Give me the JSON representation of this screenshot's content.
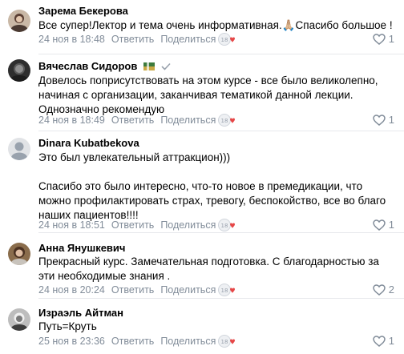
{
  "comments": [
    {
      "author": "Зарема Бекерова",
      "text": "Все супер!Лектор и тема очень информативная.🙏🏼Спасибо большое !",
      "date": "24 ноя в 18:48",
      "reply": "Ответить",
      "share": "Поделиться",
      "likes": "1"
    },
    {
      "author": "Вячеслав Сидоров",
      "text": "Довелось поприсутствовать на этом курсе - все было великолепно, начиная с организации, заканчивая тематикой данной лекции. Однозначно рекомендую",
      "date": "24 ноя в 18:49",
      "reply": "Ответить",
      "share": "Поделиться",
      "likes": "1"
    },
    {
      "author": "Dinara Kubatbekova",
      "text": "Это был увлекательный аттракцион)))\n\nСпасибо это было интересно, что-то новое в премедикации, что можно профилактировать страх, тревогу, беспокойство, все во благо наших пациентов!!!!",
      "date": "24 ноя в 18:51",
      "reply": "Ответить",
      "share": "Поделиться",
      "likes": "1"
    },
    {
      "author": "Анна Янушкевич",
      "text": "Прекрасный курс. Замечательная подготовка. С благодарностью за эти необходимые знания .",
      "date": "24 ноя в 20:24",
      "reply": "Ответить",
      "share": "Поделиться",
      "likes": "2"
    },
    {
      "author": "Израэль Айтман",
      "text": "Путь=Круть",
      "date": "25 ноя в 23:36",
      "reply": "Ответить",
      "share": "Поделиться",
      "likes": "1"
    }
  ],
  "colors": {
    "meta": "#818c99",
    "separator": "#e7e8ec",
    "heart": "#e64646"
  },
  "icons": {
    "like": "heart-outline-icon",
    "reaction": "reaction-sticker-icon",
    "verified": "check-mark-icon",
    "flag": "flag-icon"
  }
}
